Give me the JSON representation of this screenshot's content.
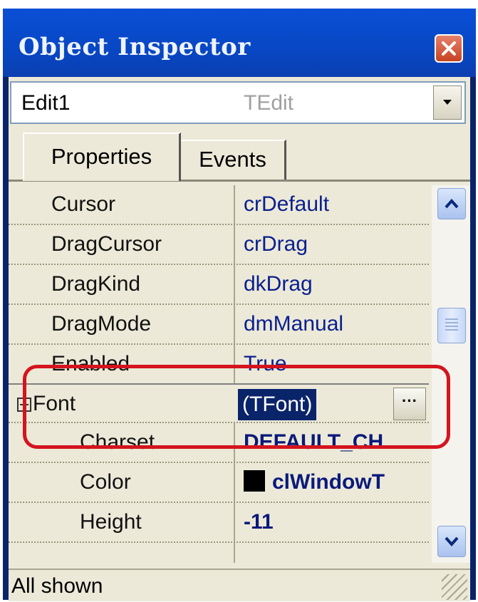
{
  "window": {
    "title": "Object Inspector"
  },
  "selector": {
    "object_name": "Edit1",
    "object_type": "TEdit"
  },
  "tabs": [
    {
      "label": "Properties",
      "active": true
    },
    {
      "label": "Events",
      "active": false
    }
  ],
  "properties": [
    {
      "name": "Cursor",
      "value": "crDefault"
    },
    {
      "name": "DragCursor",
      "value": "crDrag"
    },
    {
      "name": "DragKind",
      "value": "dkDrag"
    },
    {
      "name": "DragMode",
      "value": "dmManual"
    },
    {
      "name": "Enabled",
      "value": "True"
    },
    {
      "name": "Font",
      "value": "(TFont)",
      "expanded": true,
      "selected": true
    },
    {
      "name": "Charset",
      "value": "DEFAULT_CH",
      "sub": true
    },
    {
      "name": "Color",
      "value": "clWindowT",
      "sub": true
    },
    {
      "name": "Height",
      "value": "-11",
      "sub": true
    }
  ],
  "status": {
    "text": "All shown"
  },
  "colors": {
    "title_bar": "#0847c4",
    "selection": "#0a246a",
    "highlight_outline": "#d4141e",
    "value_text": "#0a1f8e"
  }
}
